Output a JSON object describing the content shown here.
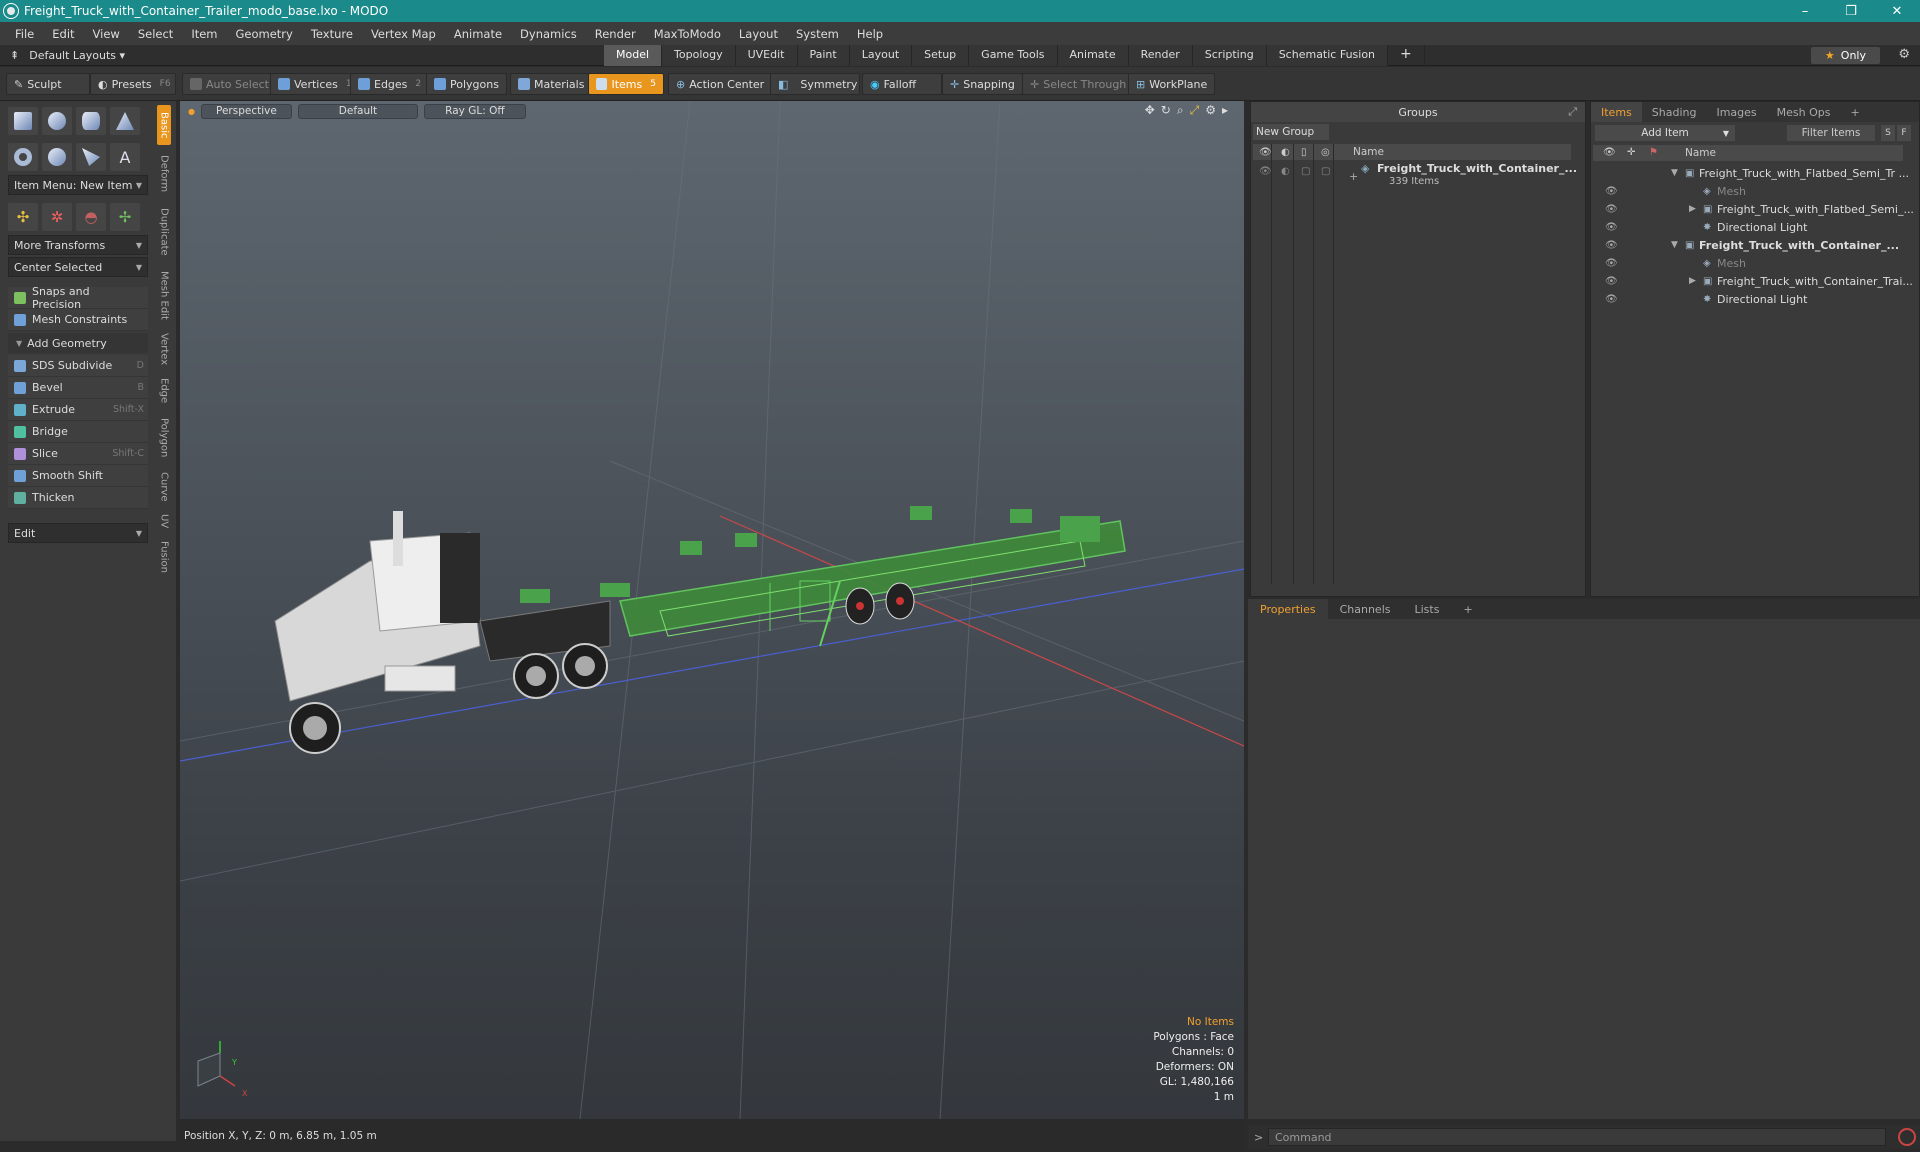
{
  "window": {
    "title": "Freight_Truck_with_Container_Trailer_modo_base.lxo - MODO",
    "minimize": "–",
    "maximize": "❐",
    "close": "✕"
  },
  "menu": [
    "File",
    "Edit",
    "View",
    "Select",
    "Item",
    "Geometry",
    "Texture",
    "Vertex Map",
    "Animate",
    "Dynamics",
    "Render",
    "MaxToModo",
    "Layout",
    "System",
    "Help"
  ],
  "layoutbar": {
    "layouts_label": "Default Layouts ▾",
    "tabs": [
      "Model",
      "Topology",
      "UVEdit",
      "Paint",
      "Layout",
      "Setup",
      "Game Tools",
      "Animate",
      "Render",
      "Scripting",
      "Schematic Fusion"
    ],
    "active_tab": "Model",
    "plus": "+",
    "only_label": "Only"
  },
  "toolbar": {
    "sculpt": "Sculpt",
    "presets": "Presets",
    "presets_key": "F6",
    "auto_select": "Auto Select",
    "vertices": "Vertices",
    "vertices_key": "1",
    "edges": "Edges",
    "edges_key": "2",
    "polygons": "Polygons",
    "materials": "Materials",
    "items": "Items",
    "items_key": "5",
    "action_center": "Action Center",
    "symmetry": "Symmetry",
    "falloff": "Falloff",
    "snapping": "Snapping",
    "select_through": "Select Through",
    "workplane": "WorkPlane"
  },
  "leftpanel": {
    "item_menu": "Item Menu: New Item",
    "more_transforms": "More Transforms",
    "center_selected": "Center Selected",
    "snaps": "Snaps and Precision",
    "mesh_constraints": "Mesh Constraints",
    "add_geometry": "Add Geometry",
    "tools": [
      {
        "label": "SDS Subdivide",
        "key": "D",
        "color": "#7aa6d8"
      },
      {
        "label": "Bevel",
        "key": "B",
        "color": "#6fa0d8"
      },
      {
        "label": "Extrude",
        "key": "Shift-X",
        "color": "#5fb0c8"
      },
      {
        "label": "Bridge",
        "key": "",
        "color": "#4fc0a0"
      },
      {
        "label": "Slice",
        "key": "Shift-C",
        "color": "#b090d8"
      },
      {
        "label": "Smooth Shift",
        "key": "",
        "color": "#6fa0d8"
      },
      {
        "label": "Thicken",
        "key": "",
        "color": "#5fb0a0"
      }
    ],
    "edit_dd": "Edit",
    "vtabs": [
      "Basic",
      "Deform",
      "Duplicate",
      "Mesh Edit",
      "Vertex",
      "Edge",
      "Polygon",
      "Curve",
      "UV",
      "Fusion"
    ]
  },
  "viewport": {
    "perspective": "Perspective",
    "default": "Default",
    "raygl": "Ray GL: Off",
    "info": {
      "no_items": "No Items",
      "polygons": "Polygons : Face",
      "channels": "Channels: 0",
      "deformers": "Deformers: ON",
      "gl": "GL: 1,480,166",
      "scale": "1 m"
    },
    "axis_y": "Y",
    "axis_x": "X"
  },
  "statusbar": {
    "position": "Position X, Y, Z:   0 m, 6.85 m, 1.05 m"
  },
  "groups": {
    "title": "Groups",
    "new_group": "New Group",
    "col_name": "Name",
    "row_name": "Freight_Truck_with_Container_...",
    "row_count": "339 Items"
  },
  "items": {
    "tabs": [
      "Items",
      "Shading",
      "Images",
      "Mesh Ops",
      "+"
    ],
    "add_item": "Add Item",
    "filter": "Filter Items",
    "s": "S",
    "f": "F",
    "col_name": "Name",
    "rows": [
      {
        "label": "Freight_Truck_with_Flatbed_Semi_Tr ...",
        "style": "normal"
      },
      {
        "label": "Mesh",
        "style": "dim"
      },
      {
        "label": "Freight_Truck_with_Flatbed_Semi_...",
        "style": "normal"
      },
      {
        "label": "Directional Light",
        "style": "normal"
      },
      {
        "label": "Freight_Truck_with_Container_...",
        "style": "bold"
      },
      {
        "label": "Mesh",
        "style": "dim"
      },
      {
        "label": "Freight_Truck_with_Container_Trai...",
        "style": "normal"
      },
      {
        "label": "Directional Light",
        "style": "normal"
      }
    ]
  },
  "properties": {
    "tabs": [
      "Properties",
      "Channels",
      "Lists",
      "+"
    ]
  },
  "command": {
    "placeholder": "Command",
    "prompt": ">"
  }
}
